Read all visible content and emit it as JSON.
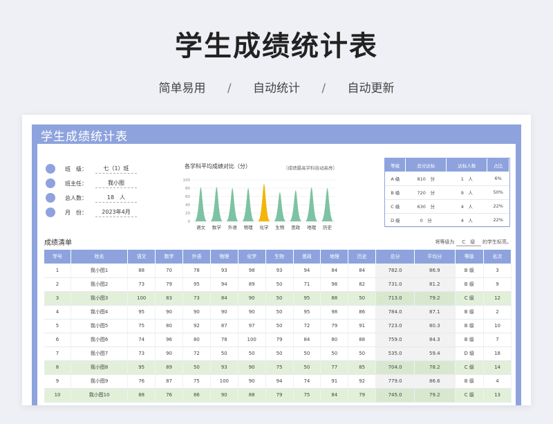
{
  "hero": {
    "title": "学生成绩统计表",
    "features": [
      "简单易用",
      "自动统计",
      "自动更新"
    ],
    "separator": "/"
  },
  "sheet": {
    "title": "学生成绩统计表"
  },
  "info": [
    {
      "label": "班　级：",
      "value": "七（1）班"
    },
    {
      "label": "班主任：",
      "value": "我小图"
    },
    {
      "label": "总人数：",
      "value": "18　人"
    },
    {
      "label": "月　份：",
      "value": "2023年4月"
    }
  ],
  "chart_data": {
    "type": "area",
    "title": "各学科平均成绩对比（分）",
    "note": "（成绩最高学科自动高亮）",
    "categories": [
      "语文",
      "数学",
      "外语",
      "物理",
      "化学",
      "生物",
      "思政",
      "地理",
      "历史"
    ],
    "values": [
      82,
      83,
      80,
      80,
      90,
      70,
      75,
      82,
      80
    ],
    "highlight_index": 4,
    "ylim": [
      0,
      100
    ],
    "yticks": [
      0,
      20,
      40,
      60,
      80,
      100
    ],
    "colors": {
      "normal": "#7dc2a1",
      "highlight": "#f2b50c"
    }
  },
  "grade_summary": {
    "headers": [
      "等级",
      "总分达标",
      "达标人数",
      "占比"
    ],
    "rows": [
      [
        "A 级",
        "810　分",
        "1　人",
        "6%"
      ],
      [
        "B 级",
        "720　分",
        "9　人",
        "50%"
      ],
      [
        "C 级",
        "630　分",
        "4　人",
        "22%"
      ],
      [
        "D 级",
        "0　分",
        "4　人",
        "22%"
      ]
    ]
  },
  "list": {
    "title": "成绩清单",
    "note_prefix": "将等级为",
    "note_value": "C　级",
    "note_suffix": "的学生标亮。",
    "headers": [
      "学号",
      "姓名",
      "语文",
      "数学",
      "外语",
      "物理",
      "化学",
      "生物",
      "思政",
      "地理",
      "历史",
      "总分",
      "平均分",
      "等级",
      "名次"
    ],
    "rows": [
      {
        "cells": [
          "1",
          "我小图1",
          "88",
          "70",
          "78",
          "93",
          "98",
          "93",
          "94",
          "84",
          "84",
          "782.0",
          "86.9",
          "B 级",
          "3"
        ],
        "hl": false
      },
      {
        "cells": [
          "2",
          "我小图2",
          "73",
          "79",
          "95",
          "94",
          "89",
          "50",
          "71",
          "98",
          "82",
          "731.0",
          "81.2",
          "B 级",
          "9"
        ],
        "hl": false
      },
      {
        "cells": [
          "3",
          "我小图3",
          "100",
          "83",
          "73",
          "84",
          "90",
          "50",
          "95",
          "88",
          "50",
          "713.0",
          "79.2",
          "C 级",
          "12"
        ],
        "hl": true
      },
      {
        "cells": [
          "4",
          "我小图4",
          "95",
          "90",
          "90",
          "90",
          "90",
          "50",
          "95",
          "98",
          "86",
          "784.0",
          "87.1",
          "B 级",
          "2"
        ],
        "hl": false
      },
      {
        "cells": [
          "5",
          "我小图5",
          "75",
          "80",
          "92",
          "87",
          "97",
          "50",
          "72",
          "79",
          "91",
          "723.0",
          "80.3",
          "B 级",
          "10"
        ],
        "hl": false
      },
      {
        "cells": [
          "6",
          "我小图6",
          "74",
          "96",
          "80",
          "78",
          "100",
          "79",
          "84",
          "80",
          "88",
          "759.0",
          "84.3",
          "B 级",
          "7"
        ],
        "hl": false
      },
      {
        "cells": [
          "7",
          "我小图7",
          "73",
          "90",
          "72",
          "50",
          "50",
          "50",
          "50",
          "50",
          "50",
          "535.0",
          "59.4",
          "D 级",
          "18"
        ],
        "hl": false
      },
      {
        "cells": [
          "8",
          "我小图8",
          "95",
          "89",
          "50",
          "93",
          "90",
          "75",
          "50",
          "77",
          "85",
          "704.0",
          "78.2",
          "C 级",
          "14"
        ],
        "hl": true
      },
      {
        "cells": [
          "9",
          "我小图9",
          "76",
          "87",
          "75",
          "100",
          "90",
          "94",
          "74",
          "91",
          "92",
          "779.0",
          "86.6",
          "B 级",
          "4"
        ],
        "hl": false
      },
      {
        "cells": [
          "10",
          "我小图10",
          "88",
          "76",
          "86",
          "90",
          "88",
          "79",
          "75",
          "84",
          "79",
          "745.0",
          "79.2",
          "C 级",
          "13"
        ],
        "hl": true
      }
    ]
  }
}
